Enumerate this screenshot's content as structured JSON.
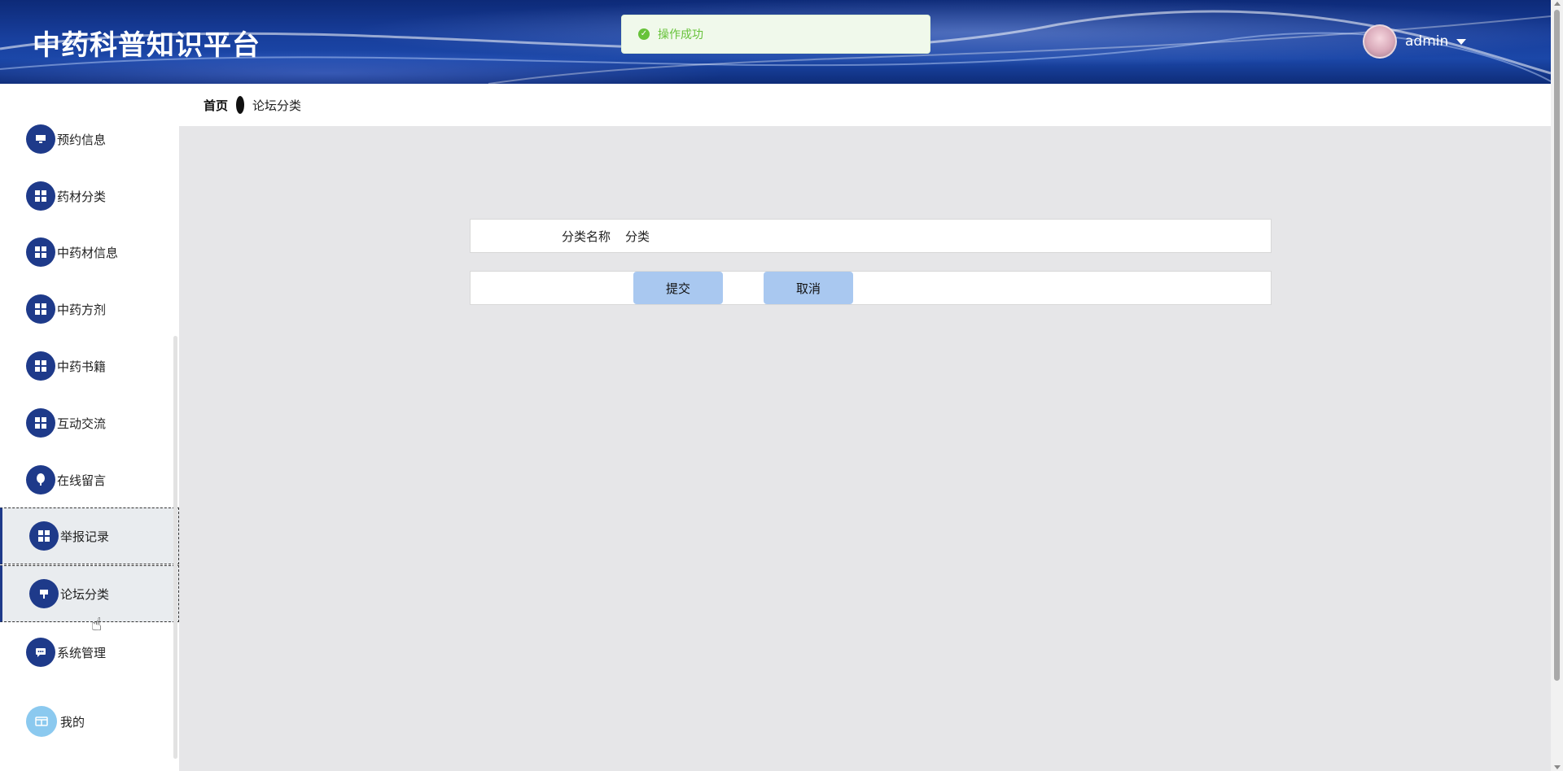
{
  "app": {
    "title": "中药科普知识平台"
  },
  "user": {
    "name": "admin"
  },
  "toast": {
    "message": "操作成功",
    "type": "success"
  },
  "breadcrumb": {
    "home": "首页",
    "current": "论坛分类"
  },
  "sidebar": {
    "items": [
      {
        "label": "预约信息",
        "icon": "monitor-icon"
      },
      {
        "label": "药材分类",
        "icon": "grid-icon"
      },
      {
        "label": "中药材信息",
        "icon": "grid-icon"
      },
      {
        "label": "中药方剂",
        "icon": "grid-icon"
      },
      {
        "label": "中药书籍",
        "icon": "grid-icon"
      },
      {
        "label": "互动交流",
        "icon": "grid-icon"
      },
      {
        "label": "在线留言",
        "icon": "balloon-icon"
      },
      {
        "label": "举报记录",
        "icon": "grid-icon"
      },
      {
        "label": "论坛分类",
        "icon": "sign-icon",
        "active": true
      },
      {
        "label": "系统管理",
        "icon": "chat-icon"
      },
      {
        "label": "我的",
        "icon": "card-icon"
      }
    ]
  },
  "form": {
    "category_label": "分类名称",
    "category_value": "分类",
    "submit_label": "提交",
    "cancel_label": "取消"
  },
  "colors": {
    "header": "#183f9d",
    "menu_icon": "#1e3a8a",
    "button": "#a9c8f0",
    "success": "#67c23a"
  }
}
